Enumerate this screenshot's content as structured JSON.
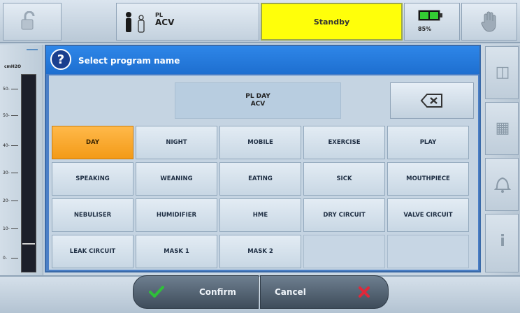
{
  "topbar": {
    "patient_line1": "PL",
    "patient_mode": "ACV",
    "status": "Standby",
    "battery_pct": "85%"
  },
  "left_monitor": {
    "unit": "cmH2O",
    "ticks": [
      "50-",
      "50-",
      "40-",
      "30-",
      "20-",
      "10-",
      "0-"
    ]
  },
  "dialog": {
    "title": "Select program name",
    "preview_line1": "PL DAY",
    "preview_line2": "ACV"
  },
  "keys": [
    "DAY",
    "NIGHT",
    "MOBILE",
    "EXERCISE",
    "PLAY",
    "SPEAKING",
    "WEANING",
    "EATING",
    "SICK",
    "MOUTHPIECE",
    "NEBULISER",
    "HUMIDIFIER",
    "HME",
    "DRY CIRCUIT",
    "VALVE CIRCUIT",
    "LEAK CIRCUIT",
    "MASK 1",
    "MASK 2"
  ],
  "selected_key": "DAY",
  "buttons": {
    "confirm": "Confirm",
    "cancel": "Cancel"
  },
  "icons": {
    "lock": "unlock-icon",
    "patient": "person-icon",
    "battery": "battery-icon",
    "alarm": "hand-icon",
    "help": "help-icon",
    "backspace": "backspace-icon",
    "confirm": "checkmark-icon",
    "cancel": "x-icon"
  },
  "colors": {
    "status_bg": "#ffff0a",
    "selected_key": "#f39a17",
    "header": "#1e6fd0",
    "confirm_check": "#2fbf3a",
    "cancel_x": "#e0283a"
  }
}
